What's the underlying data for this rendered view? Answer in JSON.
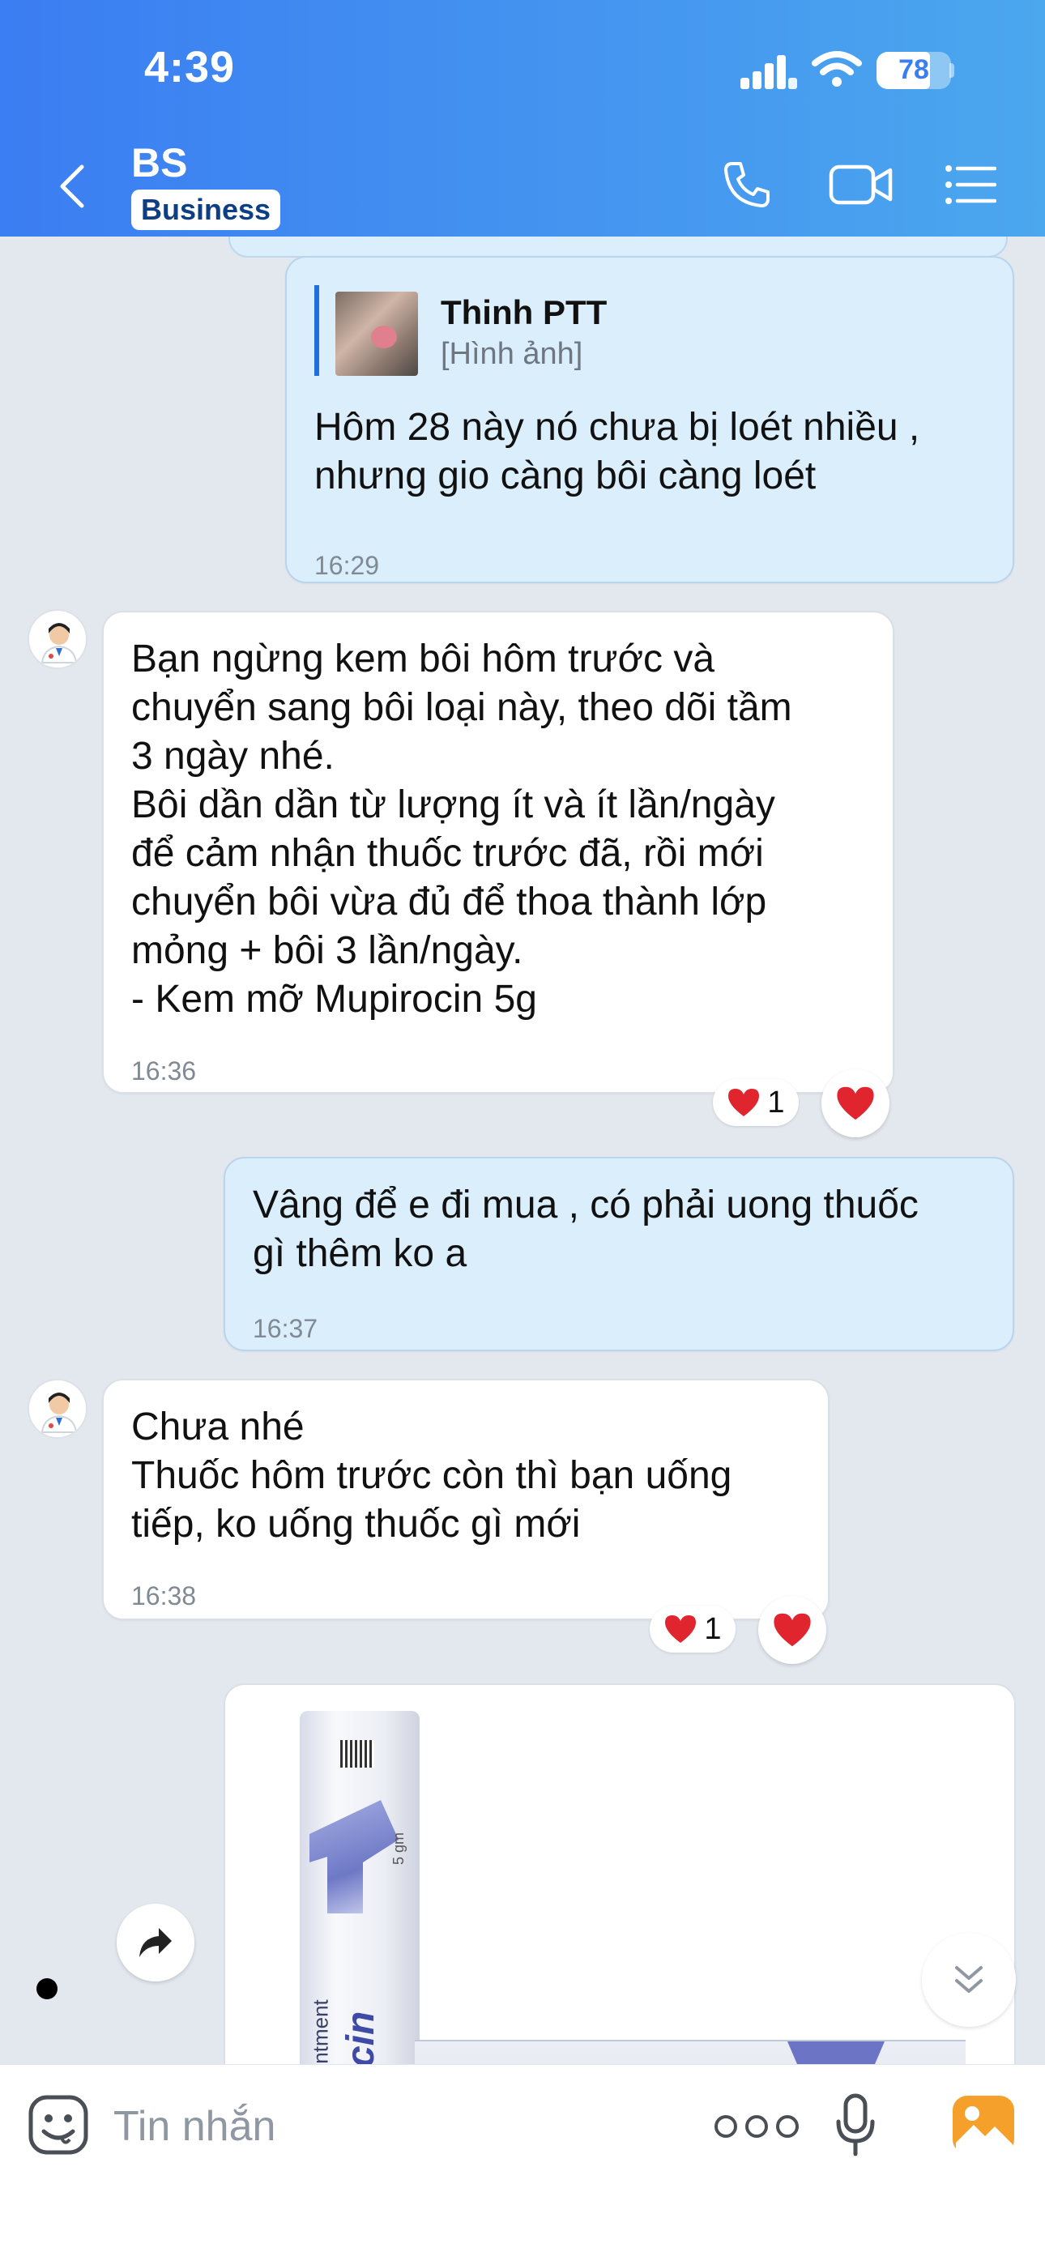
{
  "status_bar": {
    "time": "4:39",
    "battery": "78"
  },
  "header": {
    "contact_name": "BS",
    "badge": "Business"
  },
  "messages": [
    {
      "quote_sender": "Thinh PTT",
      "quote_type": "[Hình ảnh]",
      "text": "Hôm 28 này nó chưa bị loét nhiều ,\nnhưng gio càng bôi càng loét",
      "time": "16:29"
    },
    {
      "text": "Bạn ngừng kem bôi hôm trước và\nchuyển sang bôi loại này, theo dõi tầm\n3 ngày nhé.\nBôi dần dần từ lượng ít và ít lần/ngày\nđể cảm nhận thuốc trước đã, rồi mới\nchuyển bôi vừa đủ để thoa thành lớp\nmỏng + bôi 3 lần/ngày.\n- Kem mỡ Mupirocin 5g",
      "time": "16:36",
      "reaction_count": "1"
    },
    {
      "text": "Vâng để e đi mua , có phải uong thuốc\ngì thêm ko a",
      "time": "16:37"
    },
    {
      "text": "Chưa nhé\nThuốc hôm trước còn thì bạn uống\ntiếp, ko uống thuốc gì mới",
      "time": "16:38",
      "reaction_count": "1"
    }
  ],
  "image_message": {
    "tube_label": "upirocin Ointment",
    "tube_brand": "upirocin",
    "tube_size": "5 gm"
  },
  "composer": {
    "placeholder": "Tin nhắn"
  },
  "colors": {
    "header_start": "#3b7df2",
    "header_end": "#4ba7ee",
    "sent_bubble": "#dbeefb",
    "received_bubble": "#ffffff",
    "reaction_heart": "#e0252f"
  }
}
